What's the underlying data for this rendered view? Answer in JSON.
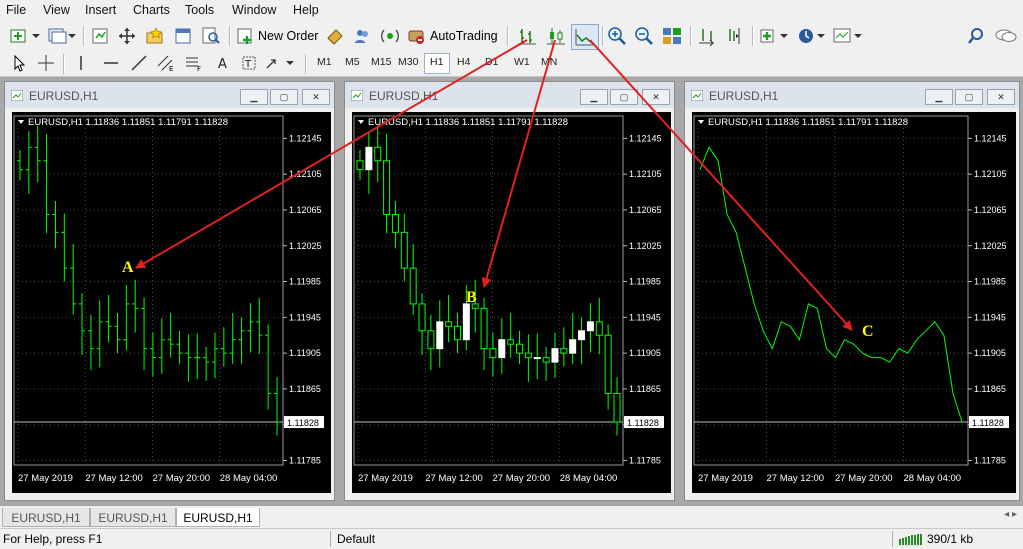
{
  "menu": [
    "File",
    "View",
    "Insert",
    "Charts",
    "Tools",
    "Window",
    "Help"
  ],
  "toolbar": {
    "new_order_label": "New Order",
    "autotrading_label": "AutoTrading",
    "timeframes": [
      "M1",
      "M5",
      "M15",
      "M30",
      "H1",
      "H4",
      "D1",
      "W1",
      "MN"
    ],
    "active_timeframe": "H1"
  },
  "windows": [
    {
      "title": "EURUSD,H1",
      "style": "bar",
      "annotation": "A"
    },
    {
      "title": "EURUSD,H1",
      "style": "candle",
      "annotation": "B"
    },
    {
      "title": "EURUSD,H1",
      "style": "line",
      "annotation": "C"
    }
  ],
  "chart_header": "EURUSD,H1  1.11836 1.11851 1.11791 1.11828",
  "chart_data": {
    "type": "line",
    "symbol": "EURUSD",
    "timeframe": "H1",
    "y_ticks": [
      "1.12145",
      "1.12105",
      "1.12065",
      "1.12025",
      "1.11985",
      "1.11945",
      "1.11905",
      "1.11865",
      "1.11825",
      "1.11785"
    ],
    "current_price": "1.11828",
    "x_ticks": [
      "27 May 2019",
      "27 May 12:00",
      "27 May 20:00",
      "28 May 04:00"
    ],
    "ylim": [
      1.1178,
      1.1217
    ],
    "close": [
      1.1211,
      1.12135,
      1.1212,
      1.1206,
      1.1204,
      1.12,
      1.1196,
      1.1193,
      1.1191,
      1.1194,
      1.11935,
      1.1192,
      1.1196,
      1.11955,
      1.1191,
      1.119,
      1.1192,
      1.11915,
      1.11905,
      1.119,
      1.119,
      1.11895,
      1.1191,
      1.11905,
      1.1192,
      1.1193,
      1.1194,
      1.11925,
      1.1186,
      1.11828
    ]
  },
  "tabs": [
    "EURUSD,H1",
    "EURUSD,H1",
    "EURUSD,H1"
  ],
  "active_tab": 2,
  "status": {
    "help_text": "For Help, press F1",
    "profile": "Default",
    "traffic": "390/1 kb"
  },
  "colors": {
    "bars": "#00ff00",
    "candle_up": "#ffffff",
    "annotation": "#ffff00",
    "arrow": "#e02020",
    "chart_bg": "#000000"
  }
}
